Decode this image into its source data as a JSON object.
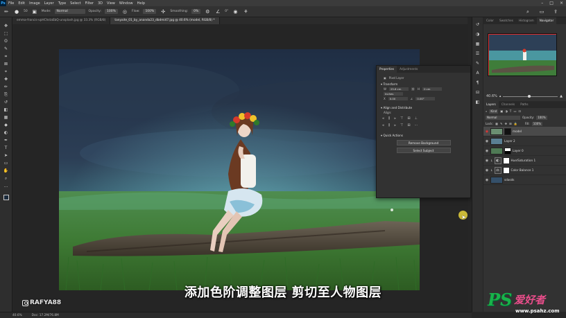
{
  "menu": {
    "app_icon": "Ps",
    "items": [
      "File",
      "Edit",
      "Image",
      "Layer",
      "Type",
      "Select",
      "Filter",
      "3D",
      "View",
      "Window",
      "Help"
    ],
    "window_controls": [
      "–",
      "□",
      "×"
    ]
  },
  "options": {
    "brush_size": "50",
    "mode_label": "Mode:",
    "mode_value": "Normal",
    "opacity_label": "Opacity:",
    "opacity_value": "100%",
    "flow_label": "Flow:",
    "flow_value": "100%",
    "smoothing_label": "Smoothing:",
    "smoothing_value": "0%",
    "angle_value": "0°"
  },
  "tabs": [
    {
      "label": "emma-francis-vpHChstaEbQ-unsplash.jpg @ 33.3% (RGB/8)",
      "active": false
    },
    {
      "label": "tanyaite_01_by_ananda23_dbdmi47.jpg @ 40.6% (model, RGB/8) *",
      "active": true
    }
  ],
  "tools": [
    "move-icon",
    "marquee-icon",
    "lasso-icon",
    "quick-select-icon",
    "crop-icon",
    "frame-icon",
    "eyedropper-icon",
    "spot-heal-icon",
    "brush-icon",
    "stamp-icon",
    "history-brush-icon",
    "eraser-icon",
    "gradient-icon",
    "blur-icon",
    "dodge-icon",
    "pen-icon",
    "type-icon",
    "path-select-icon",
    "rectangle-icon",
    "hand-icon",
    "zoom-icon",
    "more-icon"
  ],
  "tool_glyphs": [
    "✥",
    "⬚",
    "ʘ",
    "✎",
    "⌗",
    "⊠",
    "⌖",
    "✚",
    "✏",
    "⎘",
    "↺",
    "◧",
    "▦",
    "◆",
    "◐",
    "✒",
    "T",
    "➤",
    "▭",
    "✋",
    "⌕",
    "…"
  ],
  "right_panel": {
    "top_tabs": [
      "Color",
      "Swatches",
      "Histogram",
      "Navigator"
    ],
    "active_top_tab": "Navigator",
    "zoom_value": "40.6%",
    "layer_tabs": [
      "Layers",
      "Channels",
      "Paths"
    ],
    "kind_label": "Kind",
    "blend_mode": "Normal",
    "opacity_label": "Opacity:",
    "opacity_value": "100%",
    "lock_label": "Lock:",
    "fill_label": "Fill:",
    "fill_value": "100%",
    "layers": [
      {
        "name": "model",
        "visible": true,
        "selected": true,
        "type": "mask"
      },
      {
        "name": "Layer 2",
        "visible": true,
        "selected": false,
        "type": "image"
      },
      {
        "name": "Layer 0",
        "visible": true,
        "selected": false,
        "type": "mask"
      },
      {
        "name": "Hue/Saturation 1",
        "visible": true,
        "selected": false,
        "type": "adjustment"
      },
      {
        "name": "Color Balance 1",
        "visible": true,
        "selected": false,
        "type": "adjustment"
      },
      {
        "name": "sdasds",
        "visible": true,
        "selected": false,
        "type": "image"
      }
    ]
  },
  "properties": {
    "tabs": [
      "Properties",
      "Adjustments"
    ],
    "active_tab": "Properties",
    "layer_kind": "Pixel Layer",
    "transform_title": "Transform",
    "w_label": "W",
    "w_value": "25.6 cm",
    "h_label": "H",
    "h_value": "0 cm",
    "x_label": "X",
    "x_value": "0.00",
    "angle_value": "0.00°",
    "unit_value": "Inches",
    "align_title": "Align and Distribute",
    "align_label": "Align:",
    "quick_title": "Quick Actions",
    "remove_bg_label": "Remove Background",
    "select_subject_label": "Select Subject"
  },
  "status": {
    "zoom": "40.6%",
    "doc_size": "Doc: 17.2M/76.8M"
  },
  "subtitle": "添加色阶调整图层 剪切至人物图层",
  "watermark": "RAFYA88",
  "brand": {
    "ps": "PS",
    "cn": "爱好者",
    "url": "www.psahz.com"
  },
  "colors": {
    "accent": "#e03030",
    "brand_green": "#19b24a",
    "brand_pink": "#e84d8a"
  }
}
